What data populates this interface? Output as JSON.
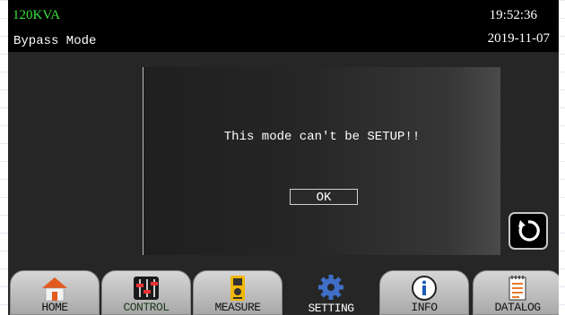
{
  "status": {
    "capacity": "120KVA",
    "mode": "Bypass Mode",
    "time": "19:52:36",
    "date": "2019-11-07"
  },
  "dialog": {
    "message": "This mode can't be SETUP!!",
    "ok_label": "OK"
  },
  "nav": {
    "tabs": [
      {
        "label": "HOME",
        "icon": "home-icon"
      },
      {
        "label": "CONTROL",
        "icon": "sliders-icon"
      },
      {
        "label": "MEASURE",
        "icon": "meter-icon"
      },
      {
        "label": "SETTING",
        "icon": "gear-icon",
        "active": true
      },
      {
        "label": "INFO",
        "icon": "info-icon"
      },
      {
        "label": "DATALOG",
        "icon": "notepad-icon"
      }
    ]
  },
  "colors": {
    "capacity_text": "#3be23b",
    "background": "#262626",
    "topbar": "#000000"
  }
}
